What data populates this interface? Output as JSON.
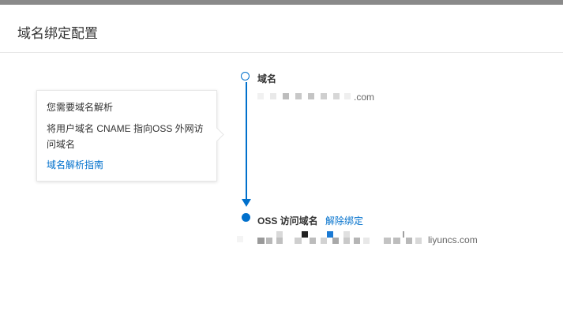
{
  "page": {
    "title": "域名绑定配置"
  },
  "tooltip": {
    "line1": "您需要域名解析",
    "line2": "将用户域名 CNAME 指向OSS 外网访问域名",
    "link": "域名解析指南"
  },
  "steps": {
    "domain": {
      "label": "域名",
      "value_suffix": ".com"
    },
    "oss": {
      "label": "OSS 访问域名",
      "action": "解除绑定",
      "value_suffix": "liyuncs.com"
    }
  },
  "colors": {
    "accent": "#0070cc",
    "topbar": "#8a8a8a"
  },
  "icons": {
    "domain_step": "hollow-circle",
    "oss_step": "filled-circle",
    "connector": "down-arrow"
  }
}
